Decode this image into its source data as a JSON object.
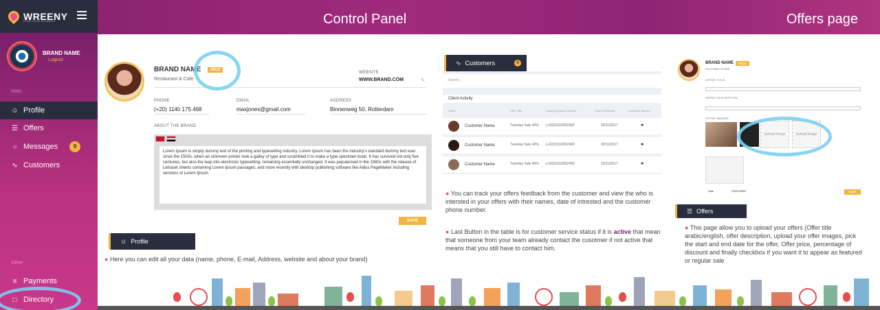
{
  "app": {
    "name": "WREENY",
    "tagline": "YOUR LOCAL BUSINESS"
  },
  "header": {
    "title": "Control Panel",
    "right_title": "Offers page"
  },
  "sidebar": {
    "brand_name": "BRAND NAME",
    "logout": "Logout",
    "section_main": "Main",
    "section_other": "Other",
    "items": [
      {
        "label": "Profile",
        "icon": "user-icon",
        "active": true
      },
      {
        "label": "Offers",
        "icon": "list-icon"
      },
      {
        "label": "Messages",
        "icon": "chat-icon",
        "badge": "9"
      },
      {
        "label": "Customers",
        "icon": "chart-icon"
      }
    ],
    "bottom_items": [
      {
        "label": "Payments",
        "icon": "database-icon"
      },
      {
        "label": "Directory",
        "icon": "folder-icon"
      }
    ]
  },
  "profile": {
    "brand_name": "BRAND NAME",
    "tier": "GOLD",
    "category": "Restaurant & Cafe",
    "website_label": "WEBSITE",
    "website": "WWW.BRAND.COM",
    "phone_label": "PHONE",
    "phone": "(+20) 1140 175 468",
    "email_label": "EMAIL",
    "email": "maxjones@gmail.com",
    "address_label": "ADDRESS",
    "address": "Binnenweg 50, Rotterdam",
    "about_label": "ABOUT THE BRAND",
    "about_text": "Lorem Ipsum is simply dummy text of the printing and typesetting industry. Lorem Ipsum has been the industry's standard dummy text ever since the 1500s, when an unknown printer took a galley of type and scrambled it to make a type specimen book. It has survived not only five centuries, but also the leap into electronic typesetting, remaining essentially unchanged. It was popularised in the 1960s with the release of Letraset sheets containing Lorem Ipsum passages, and more recently with desktop publishing software like Aldus PageMaker including versions of Lorem Ipsum",
    "save": "SAVE",
    "section_title": "Profile",
    "description": "Here you can edit all your data (name, phone, E-mail, Address, website and about your brand)"
  },
  "customers": {
    "section_title": "Customers",
    "badge": "9",
    "search_placeholder": "Search...",
    "table_title": "Client Activity",
    "columns": [
      "Client",
      "Offer Title",
      "Customer phone number",
      "Date Of Interest",
      "Customer Service"
    ],
    "rows": [
      {
        "name": "Customer Name",
        "offer": "Tuesday Sale 40%",
        "phone": "(+20)01110052493",
        "date": "20/11/2017"
      },
      {
        "name": "Customer Name",
        "offer": "Tuesday Sale 40%",
        "phone": "(+20)01110052493",
        "date": "20/11/2017"
      },
      {
        "name": "Customer Name",
        "offer": "Tuesday Sale 40%",
        "phone": "(+20)01110052493",
        "date": "20/11/2017"
      }
    ],
    "description_1": "You can track your offers feedback from the customer and view the who is intersted in your offers with their names, date of intrested and the customer phone number.",
    "description_2_prefix": "Last Button in the table is for customer service status if it is ",
    "description_2_bold": "active",
    "description_2_suffix": " that mean that someone from your team already contact the cusotmer if not active that means that you still have to contact him."
  },
  "offers": {
    "brand_name": "BRAND NAME",
    "tier": "GOLD",
    "category": "CLOTHING STORE",
    "title_label": "OFFER TITLE",
    "description_label": "OFFER DESCRIPTION",
    "images_label": "OFFER IMAGES",
    "upload_text": "Upload image",
    "featured": "Sale",
    "featured_2": "FEATURED",
    "save": "SAVE",
    "section_title": "Offers",
    "description": "This page allow you to upload your offers  (Offer title arabic/english, offer description, upload your offer images, pick the start and end date for the offer, Offer price, percentage of discount and finally checkbox if you want it to appear as featured or regular sale"
  },
  "colors": {
    "accent": "#f3b53f",
    "sidebar": "#b8317f",
    "dark": "#2a2d3e",
    "highlight": "#7ad0f2"
  }
}
